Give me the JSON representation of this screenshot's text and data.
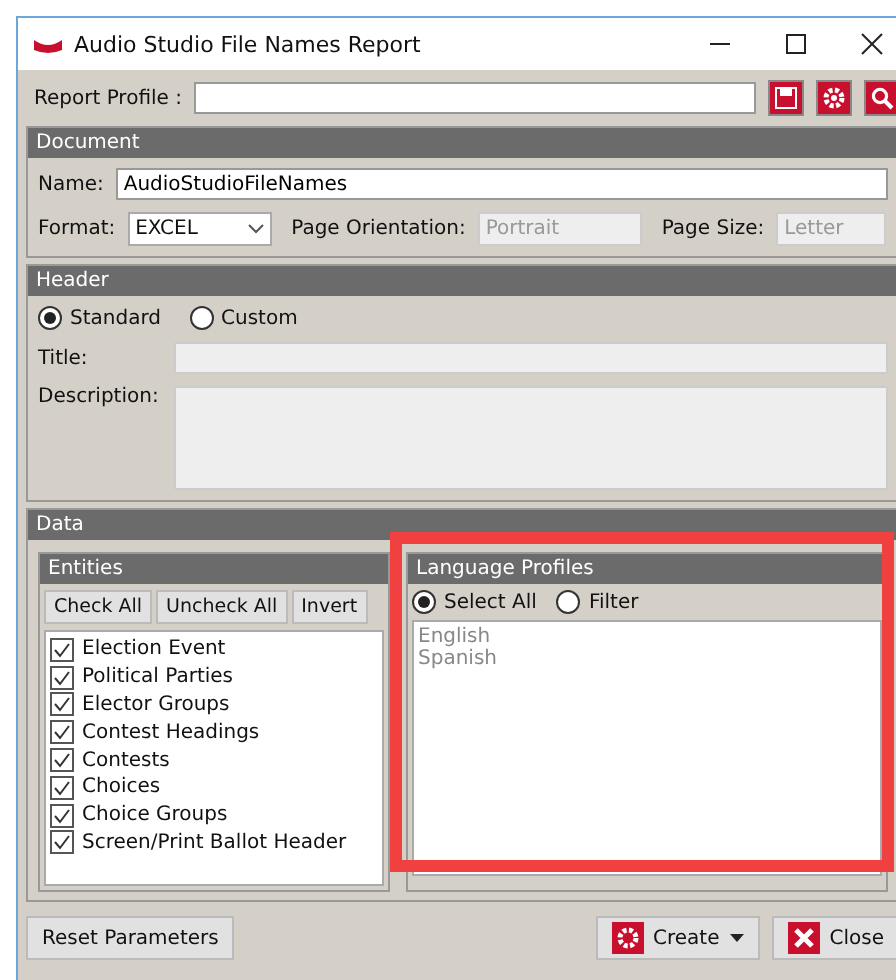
{
  "window": {
    "title": "Audio Studio File Names Report"
  },
  "report_profile": {
    "label": "Report Profile :"
  },
  "document": {
    "title": "Document",
    "name_label": "Name:",
    "name_value": "AudioStudioFileNames",
    "format_label": "Format:",
    "format_value": "EXCEL",
    "orientation_label": "Page Orientation:",
    "orientation_value": "Portrait",
    "size_label": "Page Size:",
    "size_value": "Letter"
  },
  "header": {
    "title": "Header",
    "options": [
      {
        "label": "Standard",
        "selected": true
      },
      {
        "label": "Custom",
        "selected": false
      }
    ],
    "title_label": "Title:",
    "description_label": "Description:"
  },
  "data": {
    "title": "Data",
    "entities": {
      "title": "Entities",
      "buttons": [
        "Check All",
        "Uncheck All",
        "Invert"
      ],
      "items": [
        {
          "label": "Election Event",
          "checked": true
        },
        {
          "label": "Political Parties",
          "checked": true
        },
        {
          "label": "Elector Groups",
          "checked": true
        },
        {
          "label": "Contest Headings",
          "checked": true
        },
        {
          "label": "Contests",
          "checked": true
        },
        {
          "label": "Choices",
          "checked": true
        },
        {
          "label": "Choice Groups",
          "checked": true
        },
        {
          "label": "Screen/Print Ballot Header",
          "checked": true
        }
      ]
    },
    "languages": {
      "title": "Language Profiles",
      "options": [
        {
          "label": "Select All",
          "selected": true
        },
        {
          "label": "Filter",
          "selected": false
        }
      ],
      "items": [
        "English",
        "Spanish"
      ]
    }
  },
  "footer": {
    "reset": "Reset Parameters",
    "create": "Create",
    "close": "Close"
  }
}
